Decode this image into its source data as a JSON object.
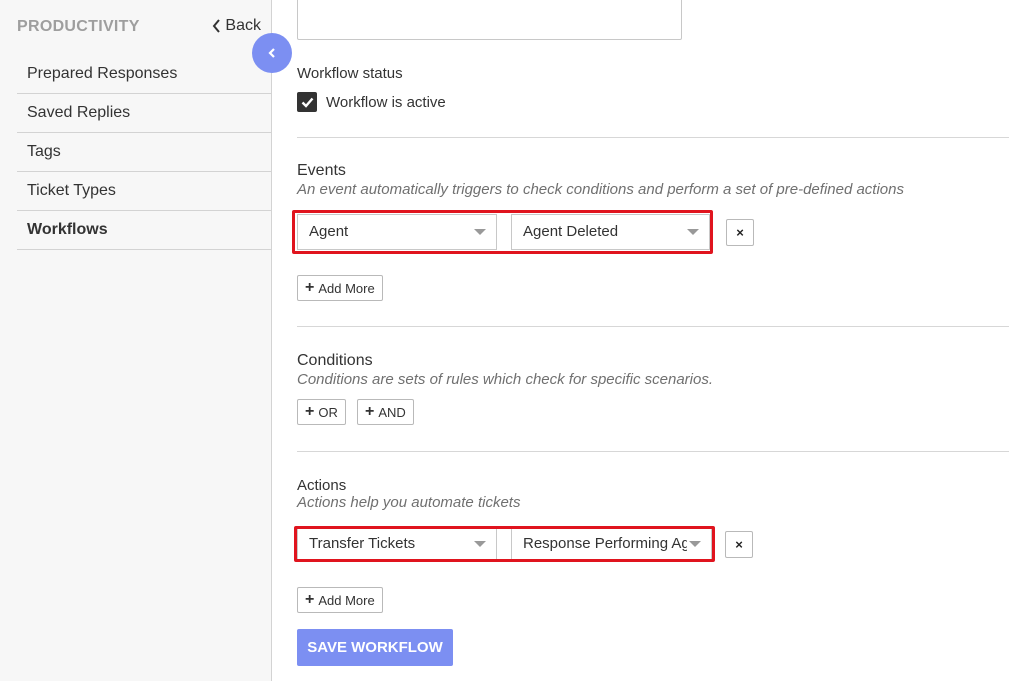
{
  "sidebar": {
    "title": "PRODUCTIVITY",
    "back_label": "Back",
    "items": [
      {
        "label": "Prepared Responses"
      },
      {
        "label": "Saved Replies"
      },
      {
        "label": "Tags"
      },
      {
        "label": "Ticket Types"
      },
      {
        "label": "Workflows",
        "active": true
      }
    ]
  },
  "workflow_status": {
    "label": "Workflow status",
    "checkbox_label": "Workflow is active",
    "checked": true
  },
  "events": {
    "title": "Events",
    "hint": "An event automatically triggers to check conditions and perform a set of pre-defined actions",
    "row": {
      "type": "Agent",
      "event": "Agent Deleted"
    },
    "remove_label": "×",
    "add_more_label": "Add More"
  },
  "conditions": {
    "title": "Conditions",
    "hint": "Conditions are sets of rules which check for specific scenarios.",
    "or_label": "OR",
    "and_label": "AND"
  },
  "actions": {
    "title": "Actions",
    "hint": "Actions help you automate tickets",
    "row": {
      "action": "Transfer Tickets",
      "value": "Response Performing Agent"
    },
    "remove_label": "×",
    "add_more_label": "Add More"
  },
  "save_label": "SAVE WORKFLOW",
  "colors": {
    "accent": "#7c8ff2",
    "highlight": "#e0141e"
  }
}
